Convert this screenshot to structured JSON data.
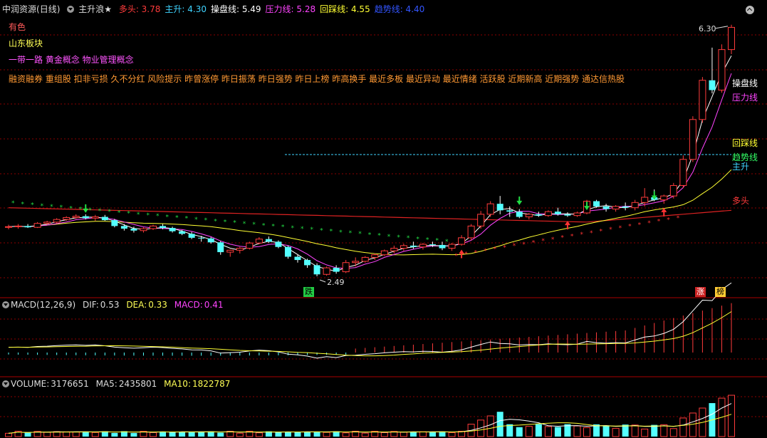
{
  "header": {
    "stock_name": "中润资源",
    "period": "(日线)",
    "indicator": "主升浪★",
    "items": [
      {
        "label": "多头:",
        "value": "3.78",
        "color": "#ff3b3b"
      },
      {
        "label": "主升:",
        "value": "4.30",
        "color": "#3fd3ff"
      },
      {
        "label": "操盘线:",
        "value": "5.49",
        "color": "#ffffff"
      },
      {
        "label": "压力线:",
        "value": "5.28",
        "color": "#ff44ff"
      },
      {
        "label": "回踩线:",
        "value": "4.55",
        "color": "#ffff33"
      },
      {
        "label": "趋势线:",
        "value": "4.40",
        "color": "#3355ff"
      }
    ]
  },
  "tags": {
    "line1": "有色",
    "line2": "山东板块",
    "line3": "一带一路 黄金概念 物业管理概念",
    "line4": "融资融券 重组股 扣非亏损 久不分红 风险提示 昨曾涨停 昨日振荡 昨日强势 昨日上榜 昨高换手 最近多板 最近异动 最近情绪 活跃股 近期新高 近期强势 通达信热股"
  },
  "price_panel": {
    "high_label": "6.30",
    "low_label": "2.49",
    "right_labels": [
      {
        "text": "操盘线",
        "color": "#ffffff"
      },
      {
        "text": "压力线",
        "color": "#ff44ff"
      },
      {
        "text": "回踩线",
        "color": "#ffff33"
      },
      {
        "text": "趋势线",
        "color": "#33ff66"
      },
      {
        "text": "主升",
        "color": "#3fd3ff"
      },
      {
        "text": "多头",
        "color": "#ff3b3b"
      }
    ],
    "bottom_badges": [
      {
        "text": "跌",
        "color": "#000000",
        "bg": "#22cc44"
      },
      {
        "text": "涨",
        "color": "#ffffff",
        "bg": "#cc2222"
      },
      {
        "text": "榜",
        "color": "#000000",
        "bg": "#ffcc33"
      }
    ]
  },
  "macd_panel": {
    "label": "MACD(12,26,9)",
    "dif_label": "DIF:",
    "dif_value": "0.53",
    "dea_label": "DEA:",
    "dea_value": "0.33",
    "macd_label": "MACD:",
    "macd_value": "0.41"
  },
  "volume_panel": {
    "label": "VOLUME:",
    "value": "3176651",
    "ma5_label": "MA5:",
    "ma5_value": "2435801",
    "ma10_label": "MA10:",
    "ma10_value": "1822787"
  },
  "colors": {
    "up": "#ff3b3b",
    "down": "#54ffff",
    "grid": "#8b0000",
    "background": "#000000"
  }
}
